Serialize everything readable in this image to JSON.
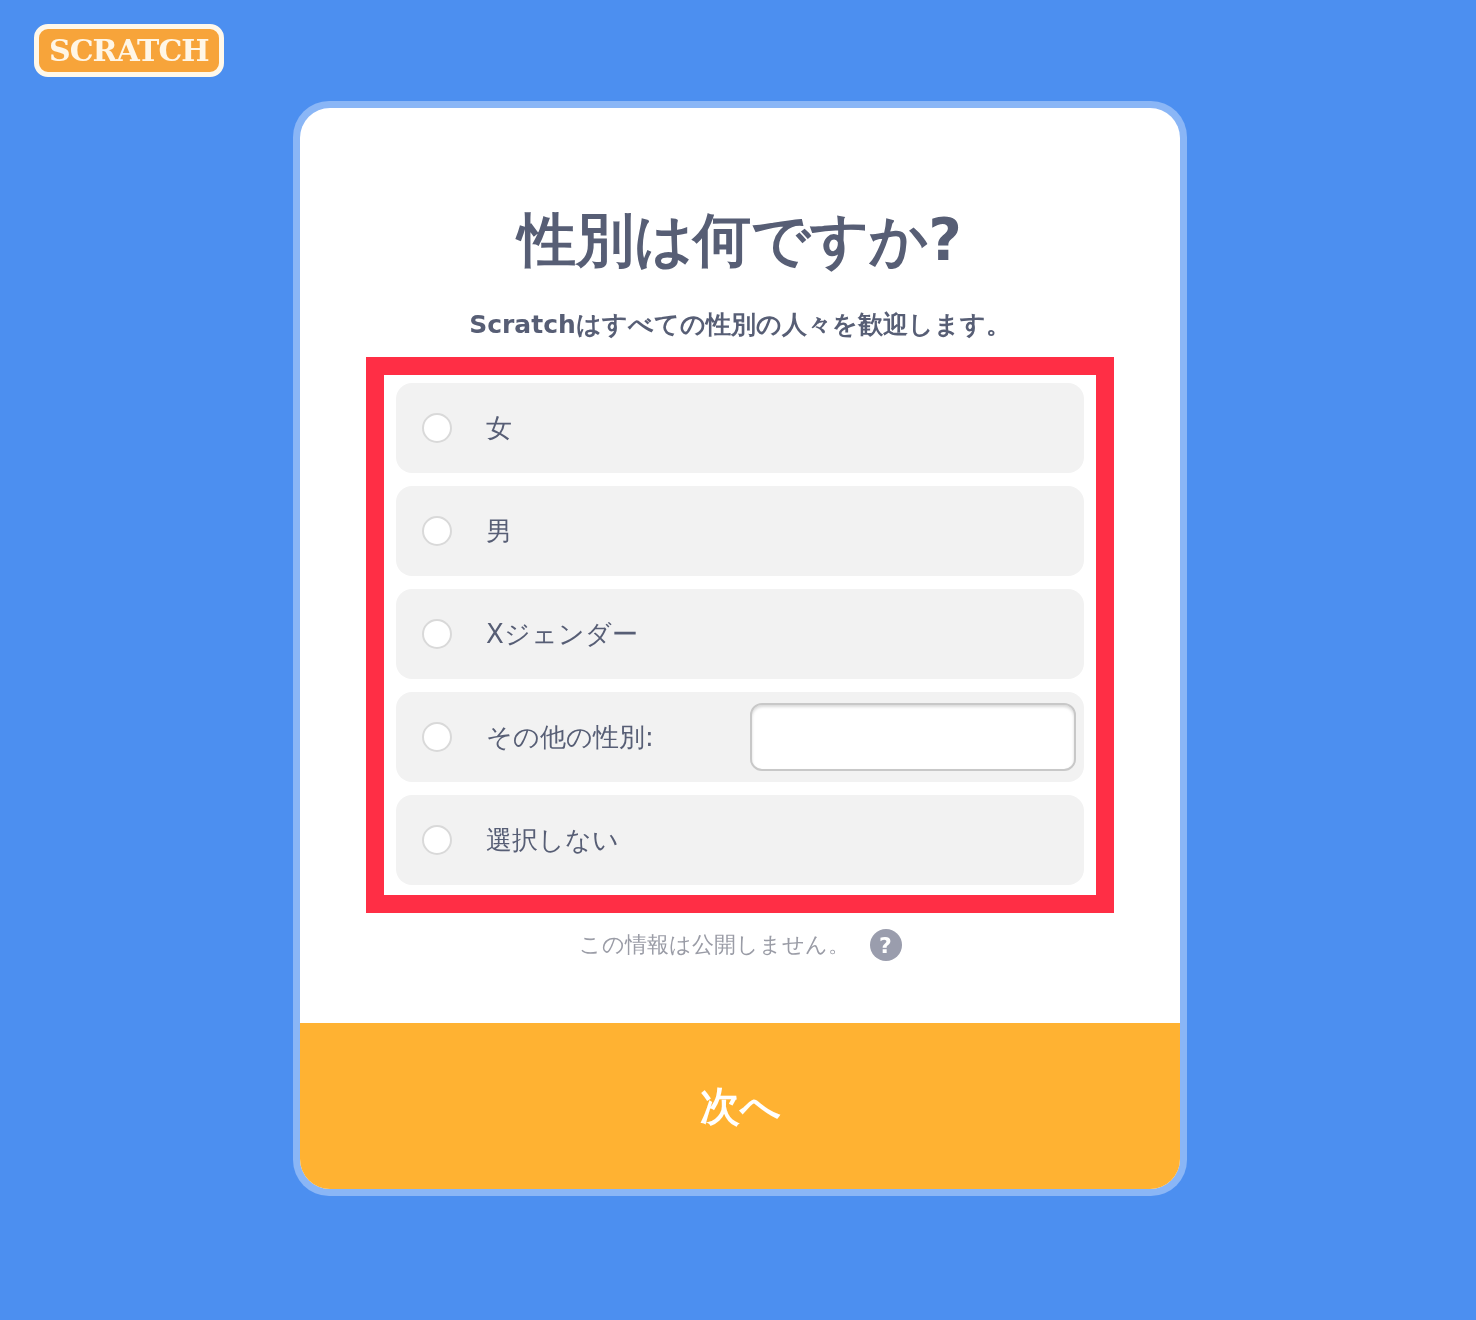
{
  "logo": {
    "text": "SCRATCH"
  },
  "title": "性別は何ですか?",
  "subtitle": "Scratchはすべての性別の人々を歓迎します。",
  "options": [
    {
      "kind": "radio",
      "label": "女",
      "selected": false
    },
    {
      "kind": "radio",
      "label": "男",
      "selected": false
    },
    {
      "kind": "radio",
      "label": "Xジェンダー",
      "selected": false
    },
    {
      "kind": "other",
      "label": "その他の性別:",
      "selected": false
    },
    {
      "kind": "radio",
      "label": "選択しない",
      "selected": false
    }
  ],
  "privacy_note": {
    "text": "この情報は公開しません。",
    "icon": "?"
  },
  "next_button": {
    "label": "次へ"
  }
}
